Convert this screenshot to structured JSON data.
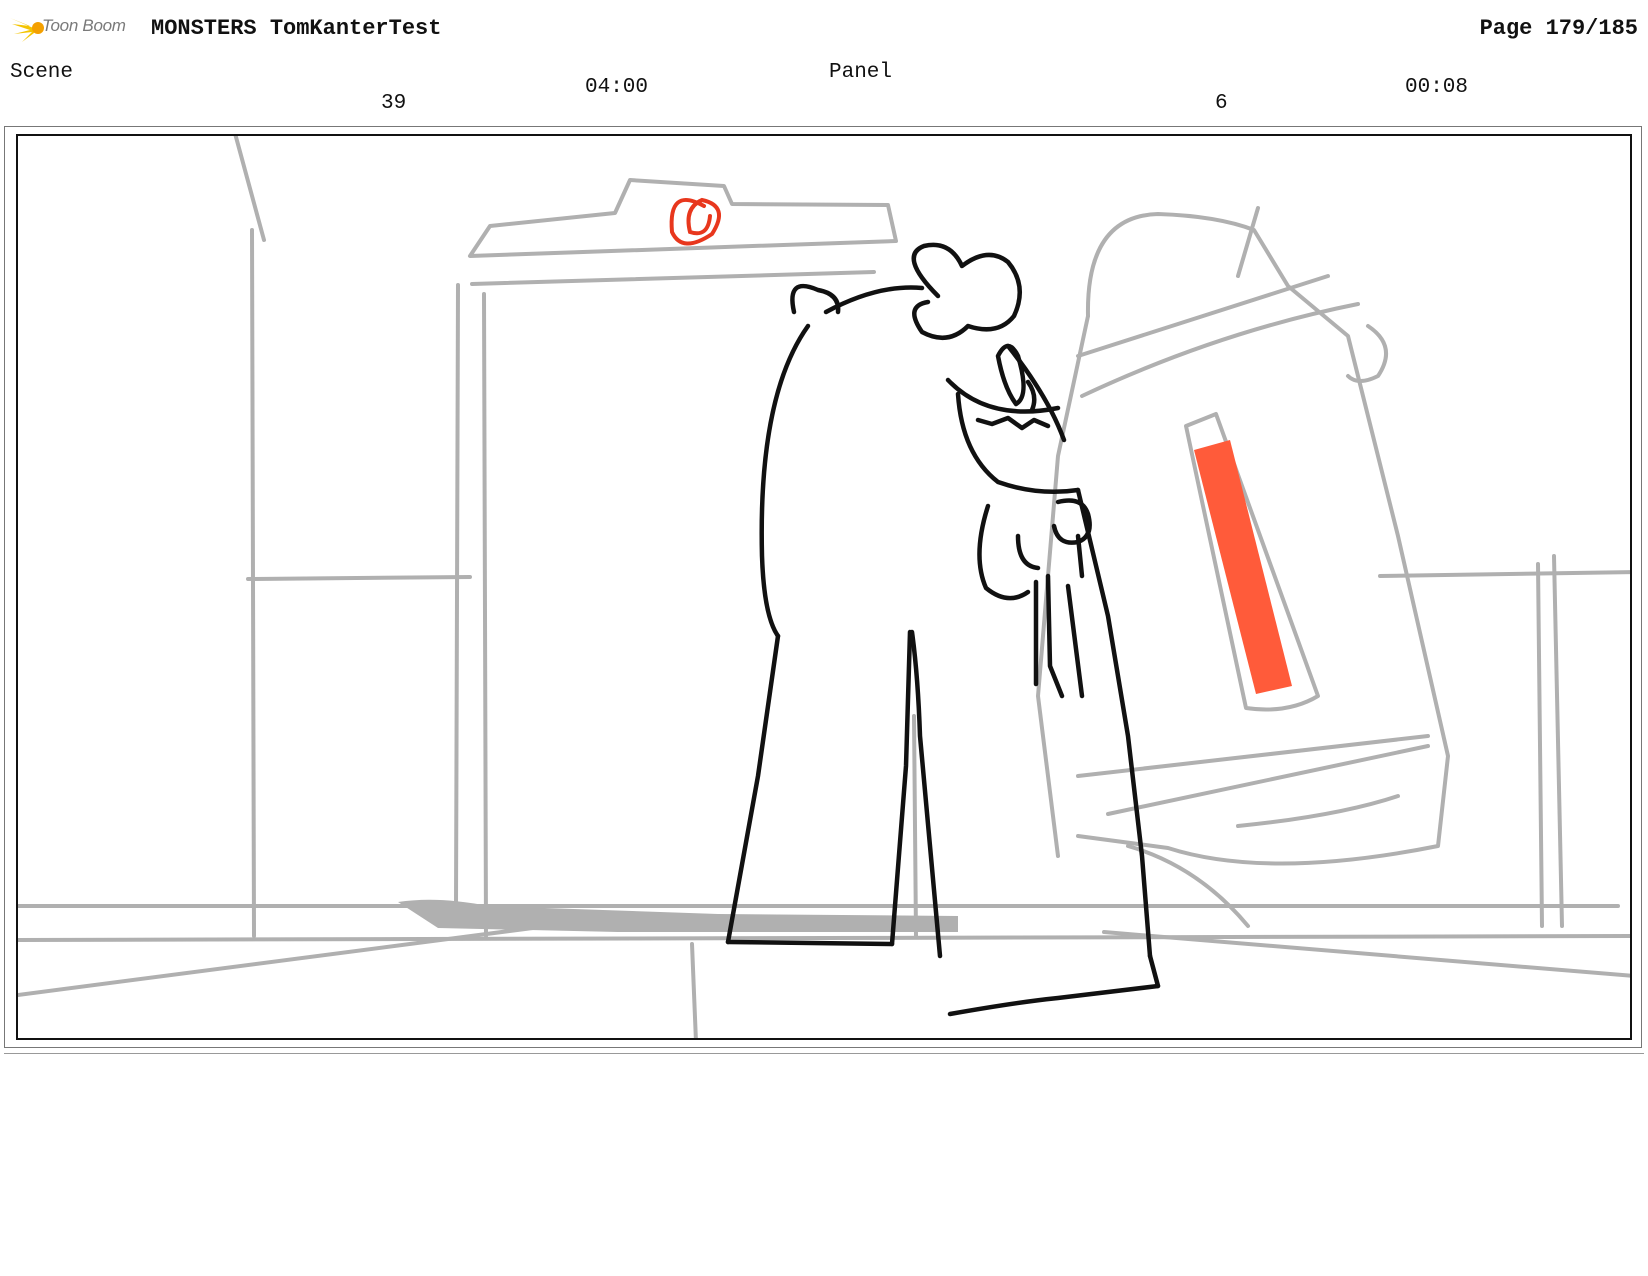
{
  "header": {
    "logo_text": "Toon Boom",
    "title": "MONSTERS TomKanterTest",
    "page": "Page 179/185"
  },
  "scene": {
    "label": "Scene",
    "number": "39",
    "duration": "04:00"
  },
  "panel": {
    "label": "Panel",
    "number": "6",
    "duration": "00:08"
  },
  "colors": {
    "sketch_gray": "#b0b0b0",
    "ink": "#111111",
    "accent_red": "#e8371d",
    "screen_orange": "#ff5b3a"
  }
}
